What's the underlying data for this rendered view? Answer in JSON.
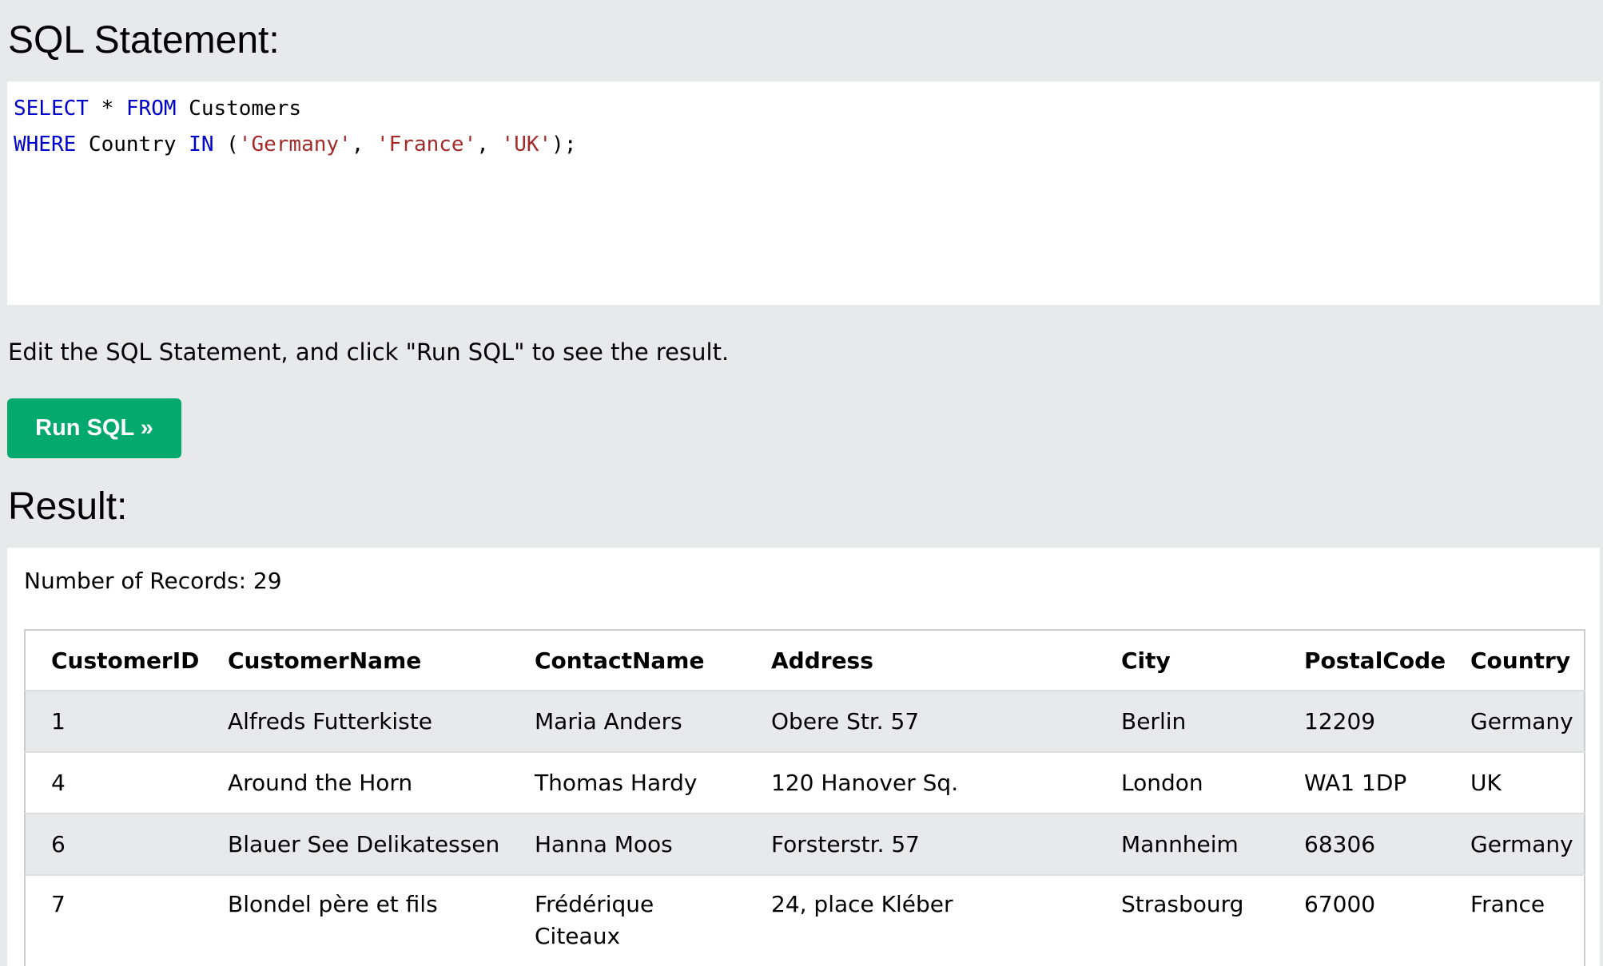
{
  "sql_heading": "SQL Statement:",
  "editor": {
    "line1": {
      "kw1": "SELECT",
      "op": " * ",
      "kw2": "FROM",
      "rest": " Customers"
    },
    "line2": {
      "kw1": "WHERE",
      "mid1": " Country ",
      "kw2": "IN",
      "open": " (",
      "s1": "'Germany'",
      "sep1": ", ",
      "s2": "'France'",
      "sep2": ", ",
      "s3": "'UK'",
      "close": ");"
    }
  },
  "hint": "Edit the SQL Statement, and click \"Run SQL\" to see the result.",
  "run_button": "Run SQL »",
  "result_heading": "Result:",
  "record_count": "Number of Records: 29",
  "table": {
    "headers": [
      "CustomerID",
      "CustomerName",
      "ContactName",
      "Address",
      "City",
      "PostalCode",
      "Country"
    ],
    "rows": [
      [
        "1",
        "Alfreds Futterkiste",
        "Maria Anders",
        "Obere Str. 57",
        "Berlin",
        "12209",
        "Germany"
      ],
      [
        "4",
        "Around the Horn",
        "Thomas Hardy",
        "120 Hanover Sq.",
        "London",
        "WA1 1DP",
        "UK"
      ],
      [
        "6",
        "Blauer See Delikatessen",
        "Hanna Moos",
        "Forsterstr. 57",
        "Mannheim",
        "68306",
        "Germany"
      ],
      [
        "7",
        "Blondel père et fils",
        "Frédérique Citeaux",
        "24, place Kléber",
        "Strasbourg",
        "67000",
        "France"
      ]
    ]
  },
  "colors": {
    "page_bg": "#e7e9eb",
    "button_bg": "#04aa6d",
    "keyword": "#0000cd",
    "string": "#a52a2a"
  }
}
